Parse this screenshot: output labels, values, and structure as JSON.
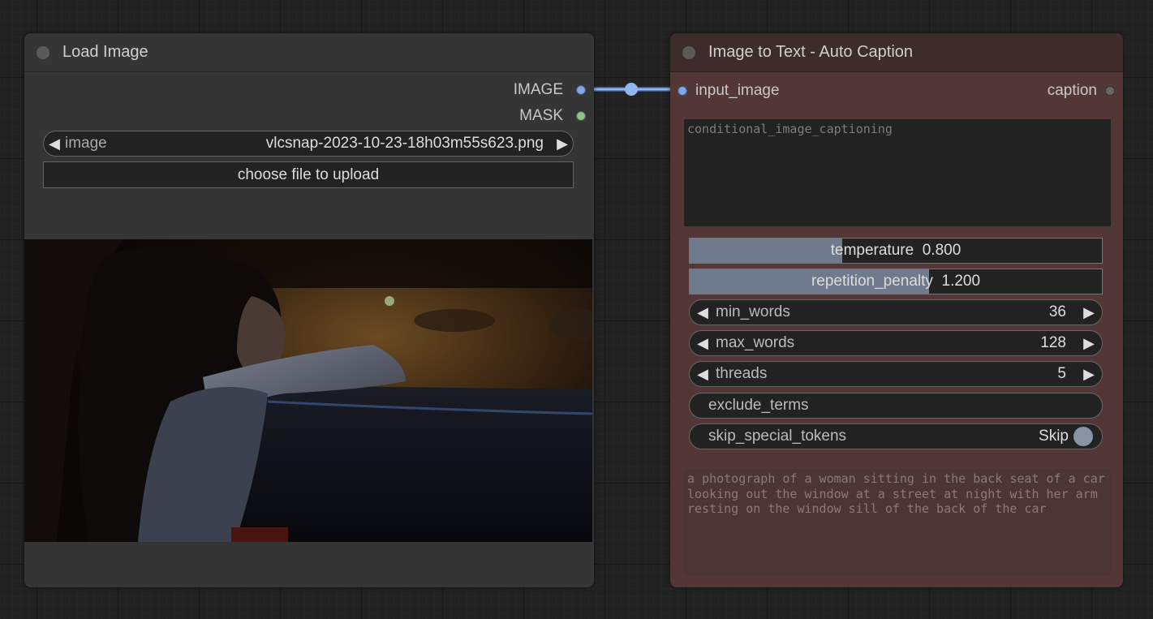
{
  "load_node": {
    "title": "Load Image",
    "outputs": [
      {
        "label": "IMAGE",
        "color": "#7fa7e8"
      },
      {
        "label": "MASK",
        "color": "#8fc48a"
      }
    ],
    "image_widget": {
      "label": "image",
      "value": "vlcsnap-2023-10-23-18h03m55s623.png"
    },
    "upload_label": "choose file to upload"
  },
  "caption_node": {
    "title": "Image to Text - Auto Caption",
    "input_label": "input_image",
    "output_label": "caption",
    "prompt_text": "conditional_image_captioning",
    "temperature": {
      "label": "temperature",
      "value": "0.800",
      "fill_fraction": 0.37
    },
    "repetition_penalty": {
      "label": "repetition_penalty",
      "value": "1.200",
      "fill_fraction": 0.58
    },
    "min_words": {
      "label": "min_words",
      "value": "36"
    },
    "max_words": {
      "label": "max_words",
      "value": "128"
    },
    "threads": {
      "label": "threads",
      "value": "5"
    },
    "exclude_terms": {
      "label": "exclude_terms"
    },
    "skip_special_tokens": {
      "label": "skip_special_tokens",
      "value": "Skip"
    },
    "result_text": "a photograph of a woman sitting in the back seat of a car looking out the window at a street at night with her arm resting on the window sill of the back of the car"
  },
  "colors": {
    "link": "#7fa7e8",
    "canvas_bg": "#222222",
    "caption_node_bg": "#533737"
  }
}
